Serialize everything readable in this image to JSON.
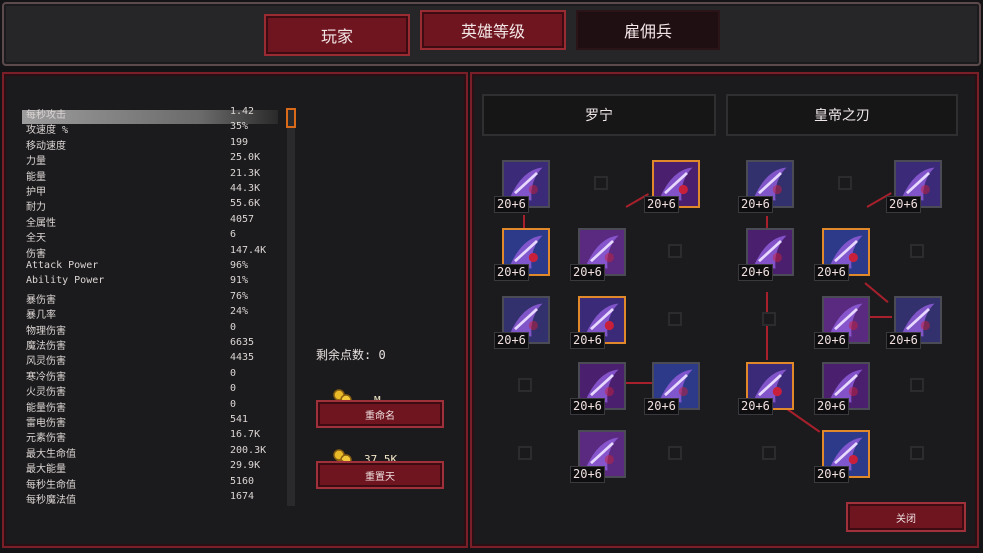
{
  "tabs": {
    "player": "玩家",
    "hero_level": "英雄等级",
    "mercenary": "雇佣兵"
  },
  "stats": [
    {
      "name": "每秒攻击",
      "value": "1.42"
    },
    {
      "name": "攻速度 %",
      "value": "35%"
    },
    {
      "name": "移动速度",
      "value": "199"
    },
    {
      "name": "力量",
      "value": "25.0K"
    },
    {
      "name": "能量",
      "value": "21.3K"
    },
    {
      "name": "护甲",
      "value": "44.3K"
    },
    {
      "name": "耐力",
      "value": "55.6K"
    },
    {
      "name": "全属性",
      "value": "4057"
    },
    {
      "name": "全天",
      "value": "6"
    },
    {
      "name": "伤害",
      "value": "147.4K"
    },
    {
      "name": "Attack Power",
      "value": "96%"
    },
    {
      "name": "Ability Power",
      "value": "91%"
    },
    {
      "name": "暴伤害",
      "value": "76%"
    },
    {
      "name": "暴几率",
      "value": "24%"
    },
    {
      "name": "物理伤害",
      "value": "0"
    },
    {
      "name": "魔法伤害",
      "value": "6635"
    },
    {
      "name": "风灵伤害",
      "value": "4435"
    },
    {
      "name": "寒冷伤害",
      "value": "0"
    },
    {
      "name": "火灵伤害",
      "value": "0"
    },
    {
      "name": "能量伤害",
      "value": "0"
    },
    {
      "name": "雷电伤害",
      "value": "541"
    },
    {
      "name": "元素伤害",
      "value": "16.7K"
    },
    {
      "name": "最大生命值",
      "value": "200.3K"
    },
    {
      "name": "最大能量",
      "value": "29.9K"
    },
    {
      "name": "每秒生命值",
      "value": "5160"
    },
    {
      "name": "每秒魔法值",
      "value": "1674"
    }
  ],
  "remaining_points": {
    "label": "剩余点数:",
    "value": "0"
  },
  "rename": {
    "cost": "M",
    "label": "重命名"
  },
  "reset": {
    "cost": "37.5K",
    "label": "重置天"
  },
  "trees": [
    {
      "title": "罗宁"
    },
    {
      "title": "皇帝之刃"
    }
  ],
  "skill_level_text": "20+6",
  "close_label": "关闭",
  "colors": {
    "accent_red": "#6e1520",
    "border_red": "#a0303a",
    "highlight_orange": "#e0892a",
    "connector": "#a8202c"
  }
}
